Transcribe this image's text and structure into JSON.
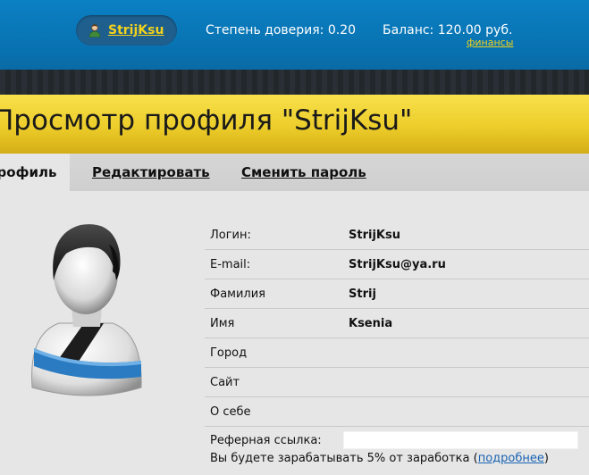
{
  "header": {
    "username": "StrijKsu",
    "trust_label": "Степень доверия: 0.20",
    "balance_label": "Баланс: 120.00 руб.",
    "finance_link": "финансы"
  },
  "page": {
    "title": "Просмотр профиля \"StrijKsu\""
  },
  "tabs": {
    "active": "Профиль",
    "edit": "Редактировать",
    "change_password": "Сменить пароль"
  },
  "profile": {
    "rows": [
      {
        "label": "Логин:",
        "value": "StrijKsu"
      },
      {
        "label": "E-mail:",
        "value": "StrijKsu@ya.ru"
      },
      {
        "label": "Фамилия",
        "value": "Strij"
      },
      {
        "label": "Имя",
        "value": "Ksenia"
      },
      {
        "label": "Город",
        "value": ""
      },
      {
        "label": "Сайт",
        "value": ""
      },
      {
        "label": "О себе",
        "value": ""
      }
    ],
    "referral_label": "Реферная ссылка:",
    "referral_value": "",
    "referral_note_before": "Вы будете зарабатывать 5% от заработка (",
    "referral_more_link": "подробнее",
    "referral_note_after": ")"
  },
  "icons": {
    "user": "user-icon",
    "avatar": "default-avatar-icon"
  },
  "colors": {
    "header_blue": "#0872b1",
    "link_yellow": "#f2d21b",
    "title_yellow": "#eccd2a",
    "link_blue": "#1a63b3"
  }
}
